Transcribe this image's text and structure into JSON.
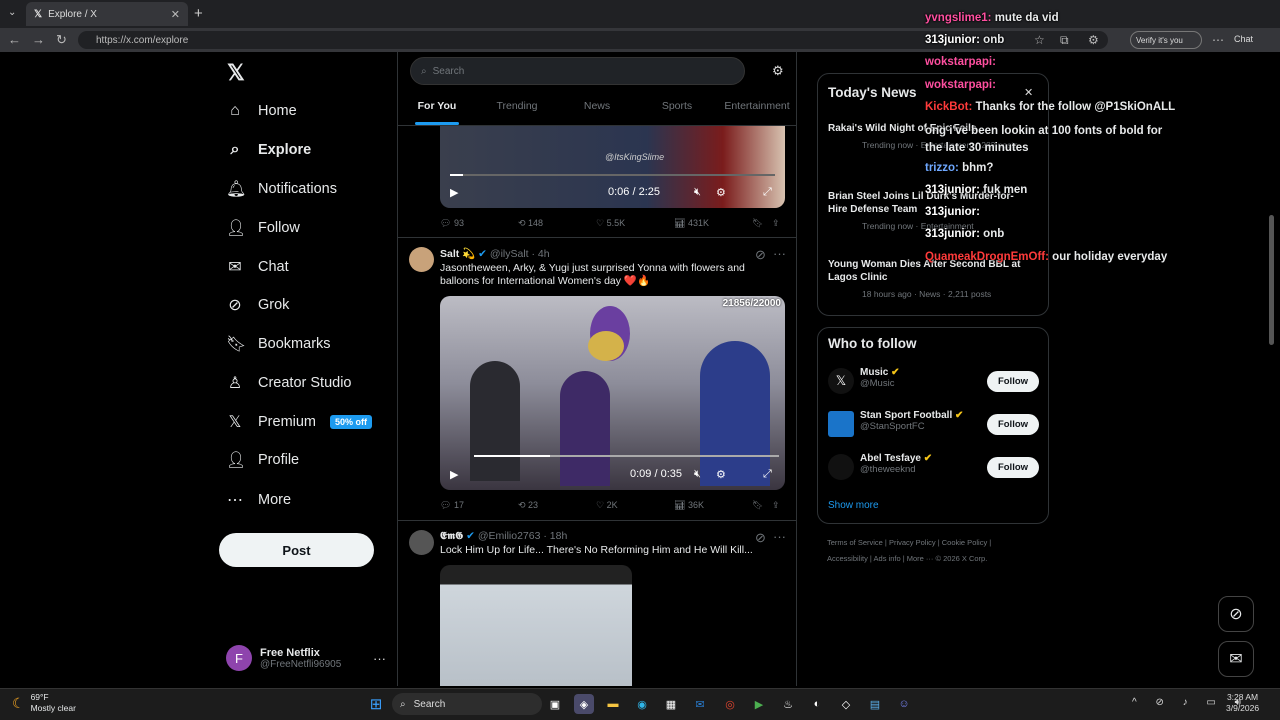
{
  "browser": {
    "tab_title": "Explore / X",
    "url": "https://x.com/explore",
    "verify_label": "Verify it's you",
    "chat_label": "Chat"
  },
  "nav": {
    "items": [
      {
        "label": "Home",
        "icon": "⌂"
      },
      {
        "label": "Explore",
        "icon": "⌕"
      },
      {
        "label": "Notifications",
        "icon": "🔔︎"
      },
      {
        "label": "Follow",
        "icon": "👤︎"
      },
      {
        "label": "Chat",
        "icon": "✉"
      },
      {
        "label": "Grok",
        "icon": "⊘"
      },
      {
        "label": "Bookmarks",
        "icon": "🔖︎"
      },
      {
        "label": "Creator Studio",
        "icon": "♙"
      },
      {
        "label": "Premium",
        "icon": "𝕏"
      },
      {
        "label": "Profile",
        "icon": "👤︎"
      },
      {
        "label": "More",
        "icon": "⋯"
      }
    ],
    "premium_badge": "50% off",
    "post": "Post",
    "account": {
      "name": "Free Netflix",
      "handle": "@FreeNetfli96905",
      "initial": "F"
    }
  },
  "center": {
    "search_placeholder": "Search",
    "tabs": [
      "For You",
      "Trending",
      "News",
      "Sports",
      "Entertainment"
    ],
    "tweet1": {
      "time": "0:06 / 2:25",
      "watermark": "@ItsKingSlime",
      "replies": "93",
      "reposts": "148",
      "likes": "5.5K",
      "views": "431K"
    },
    "tweet2": {
      "name": "Salt 💫",
      "handle": "@ilySalt · 4h",
      "text": "Jasontheween, Arky, & Yugi just surprised Yonna with flowers and balloons for International Women's day ❤️🔥",
      "counter": "21856/22000",
      "time": "0:09 / 0:35",
      "replies": "17",
      "reposts": "23",
      "likes": "2K",
      "views": "36K"
    },
    "tweet3": {
      "name": "𝕰𝖒𝕲",
      "handle": "@Emilio2763 · 18h",
      "text": "Lock Him Up for Life... There's No Reforming Him and He Will Kill..."
    }
  },
  "right": {
    "news_title": "Today's News",
    "news": [
      {
        "title": "Rakai's Wild Night of Epic Fails",
        "meta": "Trending now · Entertainment · 283 posts"
      },
      {
        "title": "Brian Steel Joins Lil Durk's Murder-for-Hire Defense Team",
        "meta": "Trending now · Entertainment"
      },
      {
        "title": "Young Woman Dies After Second BBL at Lagos Clinic",
        "meta": "18 hours ago · News · 2,211 posts"
      }
    ],
    "wtf_title": "Who to follow",
    "follow": [
      {
        "name": "Music",
        "handle": "@Music"
      },
      {
        "name": "Stan Sport Football",
        "handle": "@StanSportFC"
      },
      {
        "name": "Abel Tesfaye",
        "handle": "@theweeknd"
      }
    ],
    "follow_btn": "Follow",
    "show_more": "Show more",
    "footer1": "Terms of Service  |  Privacy Policy  |  Cookie Policy  |",
    "footer2": "Accessibility  |  Ads info  |  More ···  © 2026 X Corp."
  },
  "chat": [
    {
      "user": "yvngslime1:",
      "msg": "mute da vid",
      "color": "#ff4fa0"
    },
    {
      "user": "313junior:",
      "msg": "onb",
      "color": "#ffffff"
    },
    {
      "user": "wokstarpapi:",
      "msg": "",
      "color": "#ff4fa0"
    },
    {
      "user": "wokstarpapi:",
      "msg": "",
      "color": "#ff4fa0"
    },
    {
      "user": "KickBot:",
      "msg": "Thanks for the follow @P1SkiOnALL",
      "color": "#ff3b3b"
    },
    {
      "user": "",
      "msg": "ong i've been lookin at 100 fonts of bold for the late 30 minutes",
      "color": "#ffffff"
    },
    {
      "user": "trizzo:",
      "msg": "bhm?",
      "color": "#6fa8ff"
    },
    {
      "user": "313junior:",
      "msg": "fuk men",
      "color": "#ffffff"
    },
    {
      "user": "313junior:",
      "msg": "",
      "color": "#ffffff"
    },
    {
      "user": "313junior:",
      "msg": "onb",
      "color": "#ffffff"
    },
    {
      "user": "QuameakDrognEmOff:",
      "msg": "our holiday everyday",
      "color": "#ff3b3b"
    }
  ],
  "taskbar": {
    "weather": "69°F",
    "weather_desc": "Mostly clear",
    "search": "Search",
    "time": "3:28 AM",
    "date": "3/9/2026"
  }
}
